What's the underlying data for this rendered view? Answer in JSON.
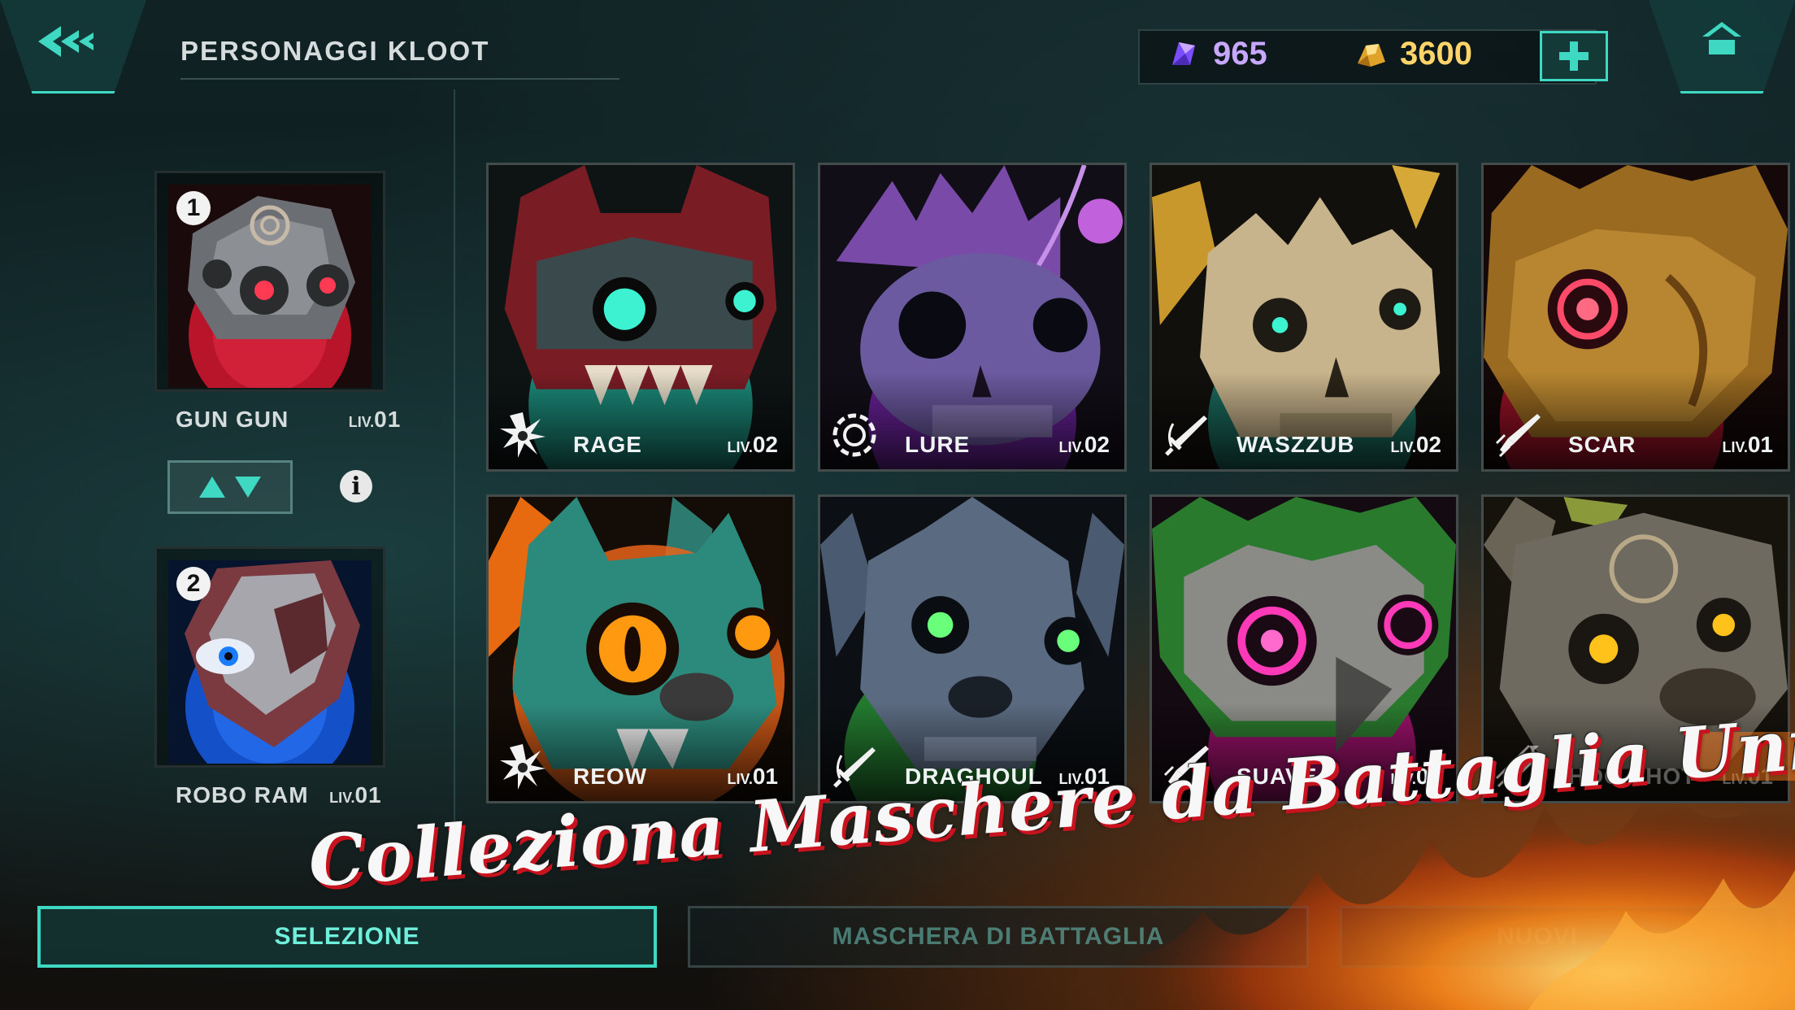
{
  "header": {
    "title": "PERSONAGGI KLOOT",
    "gems": "965",
    "gold": "3600"
  },
  "team": [
    {
      "slot": "1",
      "name": "GUN GUN",
      "lv_label": "LIV.",
      "lv": "01"
    },
    {
      "slot": "2",
      "name": "ROBO RAM",
      "lv_label": "LIV.",
      "lv": "01"
    }
  ],
  "characters": [
    {
      "name": "RAGE",
      "lv_label": "LIV.",
      "lv": "02",
      "type_icon": "burst-icon"
    },
    {
      "name": "LURE",
      "lv_label": "LIV.",
      "lv": "02",
      "type_icon": "vortex-icon"
    },
    {
      "name": "WASZZUB",
      "lv_label": "LIV.",
      "lv": "02",
      "type_icon": "sword-icon"
    },
    {
      "name": "SCAR",
      "lv_label": "LIV.",
      "lv": "01",
      "type_icon": "rocket-icon"
    },
    {
      "name": "REOW",
      "lv_label": "LIV.",
      "lv": "01",
      "type_icon": "burst-icon"
    },
    {
      "name": "DRAGHOUL",
      "lv_label": "LIV.",
      "lv": "01",
      "type_icon": "sword-icon"
    },
    {
      "name": "SUAVE",
      "lv_label": "LIV.",
      "lv": "01",
      "type_icon": "rocket-icon"
    },
    {
      "name": "HOG SHOT",
      "lv_label": "LIV.",
      "lv": "01",
      "type_icon": "arrows-icon"
    }
  ],
  "tabs": [
    {
      "label": "SELEZIONE",
      "active": true
    },
    {
      "label": "MASCHERA DI BATTAGLIA",
      "active": false
    },
    {
      "label": "NUOVI",
      "active": false
    }
  ],
  "promo": "Colleziona Maschere da Battaglia Uniche",
  "colors": {
    "accent": "#3fd8c3",
    "gem": "#c8a8ff",
    "gold": "#ffd56a",
    "promo_shadow": "#c8121e"
  }
}
